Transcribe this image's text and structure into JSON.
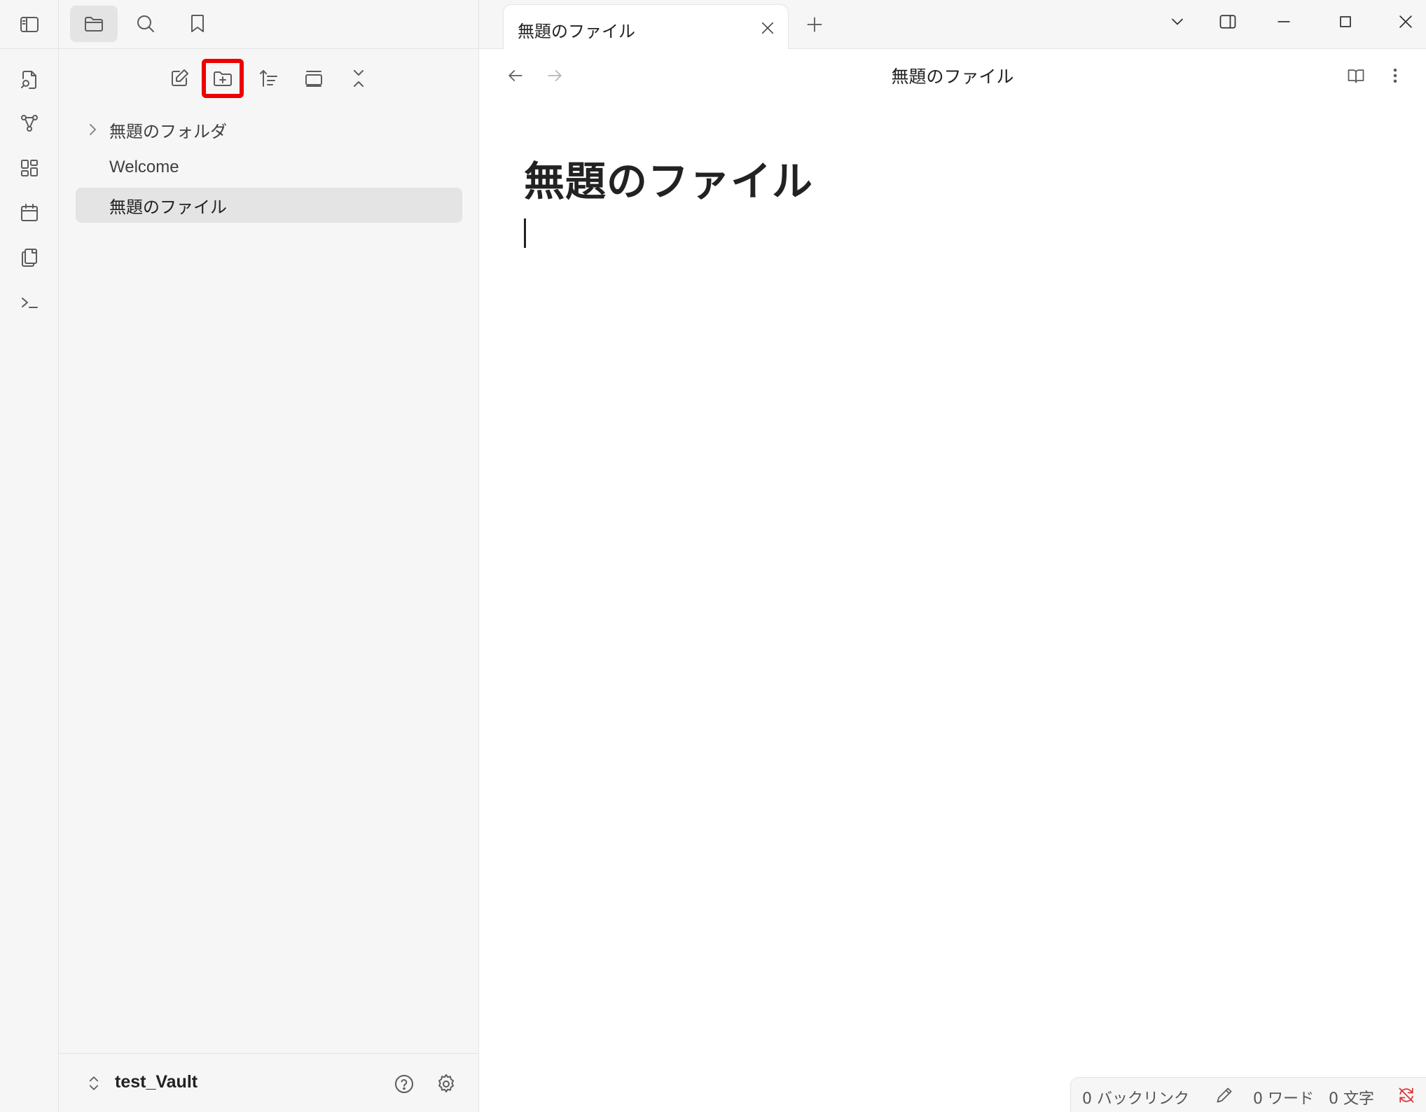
{
  "tab": {
    "title": "無題のファイル"
  },
  "view": {
    "title": "無題のファイル"
  },
  "editor": {
    "inline_title": "無題のファイル"
  },
  "file_tree": {
    "items": [
      {
        "label": "無題のフォルダ",
        "type": "folder",
        "collapsed": true
      },
      {
        "label": "Welcome",
        "type": "file"
      },
      {
        "label": "無題のファイル",
        "type": "file",
        "active": true
      }
    ]
  },
  "vault": {
    "name": "test_Vault"
  },
  "status": {
    "backlinks": "0 バックリンク",
    "words": "0 ワード",
    "chars": "0 文字"
  },
  "colors": {
    "highlight": "#ee0000",
    "sync_error": "#e03131",
    "panel": "#f6f6f6",
    "active_item": "#e4e4e4"
  }
}
